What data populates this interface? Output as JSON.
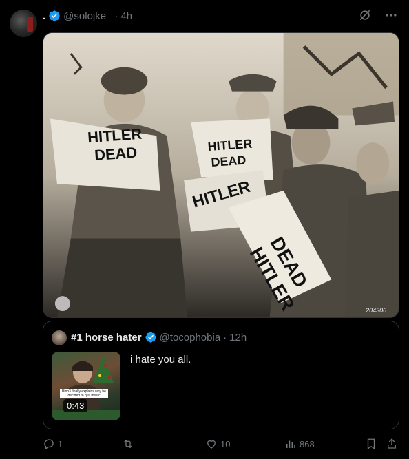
{
  "post": {
    "author_name": ".",
    "handle": "@solojke_",
    "separator": "·",
    "time": "4h",
    "verified": true
  },
  "photo": {
    "headline_word1": "HITLER",
    "headline_word2": "DEAD",
    "corner_number": "204306"
  },
  "quote": {
    "author_name": "#1 horse hater",
    "handle": "@tocophobia",
    "separator": "·",
    "time": "12h",
    "text": "i hate you all.",
    "video_duration": "0:43",
    "video_caption": "Bino3 finally explains why he decided to quit music"
  },
  "actions": {
    "replies": "1",
    "reposts": "",
    "likes": "10",
    "views": "868"
  },
  "colors": {
    "verified": "#1d9bf0",
    "muted": "#71767b",
    "text": "#e7e9ea",
    "border": "#2f3336"
  }
}
